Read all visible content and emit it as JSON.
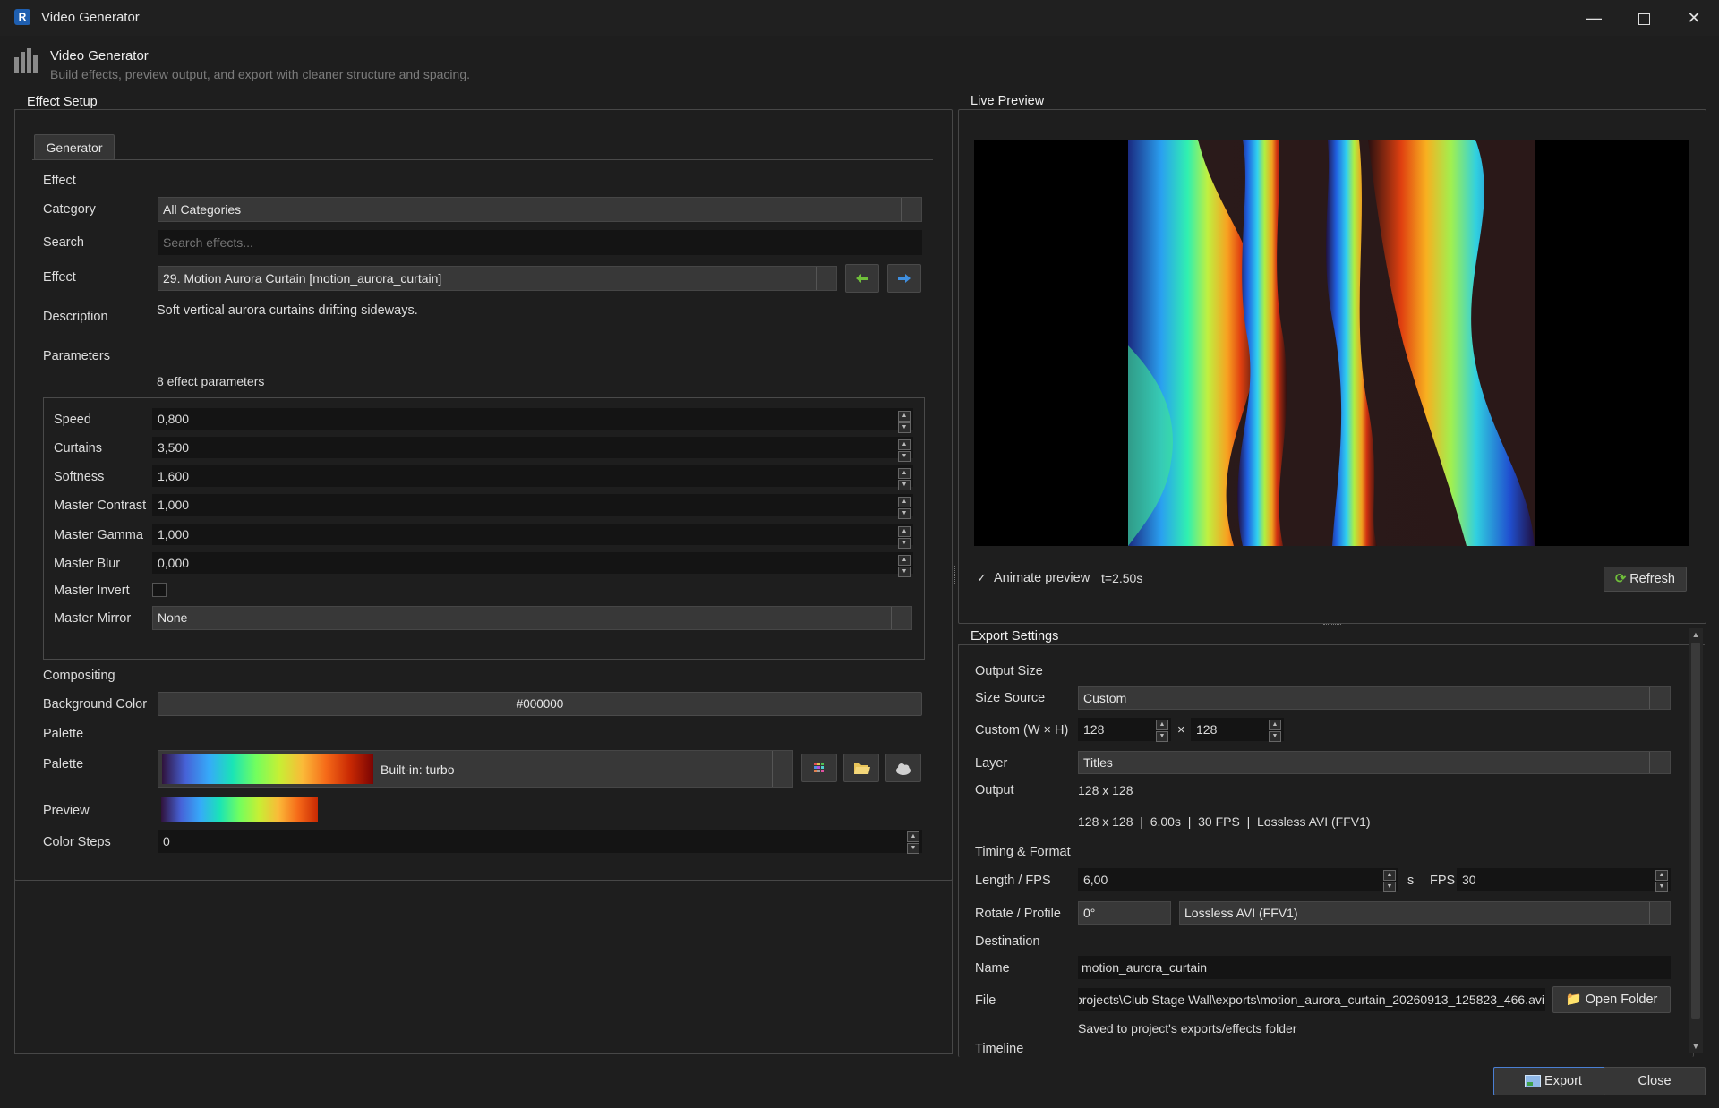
{
  "window": {
    "title": "Video Generator",
    "icon_letter": "R",
    "controls": [
      "minimize-icon",
      "maximize-icon",
      "close-icon"
    ]
  },
  "header": {
    "title": "Video Generator",
    "subtitle": "Build effects, preview output, and export with cleaner structure and spacing."
  },
  "effect_setup": {
    "title": "Effect Setup",
    "tab": "Generator",
    "effect_section": "Effect",
    "category_label": "Category",
    "category_value": "All Categories",
    "search_label": "Search",
    "search_placeholder": "Search effects...",
    "effect_label": "Effect",
    "effect_value": "29. Motion Aurora Curtain [motion_aurora_curtain]",
    "description_label": "Description",
    "description_value": "Soft vertical aurora curtains drifting sideways.",
    "parameters_label": "Parameters",
    "parameters_count": "8 effect parameters",
    "params": [
      {
        "label": "Speed",
        "value": "0,800"
      },
      {
        "label": "Curtains",
        "value": "3,500"
      },
      {
        "label": "Softness",
        "value": "1,600"
      },
      {
        "label": "Master Contrast",
        "value": "1,000"
      },
      {
        "label": "Master Gamma",
        "value": "1,000"
      },
      {
        "label": "Master Blur",
        "value": "0,000"
      }
    ],
    "master_invert_label": "Master Invert",
    "master_invert_checked": false,
    "master_mirror_label": "Master Mirror",
    "master_mirror_value": "None",
    "compositing_label": "Compositing",
    "bg_color_label": "Background Color",
    "bg_color_value": "#000000",
    "palette_section": "Palette",
    "palette_label": "Palette",
    "palette_value": "Built-in: turbo",
    "preview_label": "Preview",
    "color_steps_label": "Color Steps",
    "color_steps_value": "0"
  },
  "live_preview": {
    "title": "Live Preview",
    "animate_label": "Animate preview",
    "animate_checked": true,
    "time": "t=2.50s",
    "refresh_label": "Refresh"
  },
  "export": {
    "title": "Export Settings",
    "output_size_label": "Output Size",
    "size_source_label": "Size Source",
    "size_source_value": "Custom",
    "custom_label": "Custom (W × H)",
    "width": "128",
    "times": "×",
    "height": "128",
    "layer_label": "Layer",
    "layer_value": "Titles",
    "output_label": "Output",
    "output_value": "128 x 128",
    "summary": "128 x 128  |  6.00s  |  30 FPS  |  Lossless AVI (FFV1)",
    "timing_label": "Timing & Format",
    "length_label": "Length / FPS",
    "length_value": "6,00",
    "length_unit": "s",
    "fps_label": "FPS",
    "fps_value": "30",
    "rotate_label": "Rotate / Profile",
    "rotate_value": "0°",
    "profile_value": "Lossless AVI (FFV1)",
    "destination_label": "Destination",
    "name_label": "Name",
    "name_value": "motion_aurora_curtain",
    "file_label": "File",
    "file_value": "projects\\Club Stage Wall\\exports\\motion_aurora_curtain_20260913_125823_466.avi",
    "open_folder_label": "Open Folder",
    "saved_note": "Saved to project's exports/effects folder",
    "timeline_label": "Timeline"
  },
  "footer": {
    "export_label": "Export",
    "close_label": "Close"
  },
  "colors": {
    "background": "#1e1e1e",
    "field": "#141414",
    "accent_border": "#4a7fd4"
  }
}
